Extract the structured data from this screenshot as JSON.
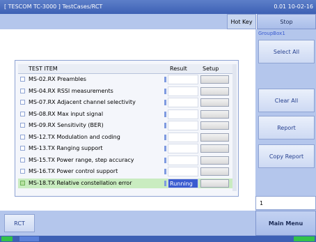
{
  "window": {
    "title": "[ TESCOM TC-3000 ] TestCases/RCT",
    "version": "0.01 10-02-16"
  },
  "toolbar": {
    "hotkey_label": "Hot Key",
    "stop_label": "Stop"
  },
  "rightpanel": {
    "group_label": "GroupBox1",
    "buttons": [
      "Select All",
      "Clear All",
      "Report",
      "Copy Report"
    ],
    "page_number": "1",
    "main_menu": "Main Menu"
  },
  "table": {
    "headers": [
      "TEST ITEM",
      "Result",
      "Setup"
    ],
    "rows": [
      {
        "name": "MS-02.RX Preambles",
        "result": ""
      },
      {
        "name": "MS-04.RX RSSI measurements",
        "result": ""
      },
      {
        "name": "MS-07.RX Adjacent channel selectivity",
        "result": ""
      },
      {
        "name": "MS-08.RX Max input signal",
        "result": ""
      },
      {
        "name": "MS-09.RX Sensitivity (BER)",
        "result": ""
      },
      {
        "name": "MS-12.TX Modulation and coding",
        "result": ""
      },
      {
        "name": "MS-13.TX Ranging support",
        "result": ""
      },
      {
        "name": "MS-15.TX Power range, step accuracy",
        "result": ""
      },
      {
        "name": "MS-16.TX Power control support",
        "result": ""
      },
      {
        "name": "MS-18.TX Relative constellation error",
        "result": "Running"
      }
    ]
  },
  "bottom": {
    "rct_label": "RCT"
  }
}
